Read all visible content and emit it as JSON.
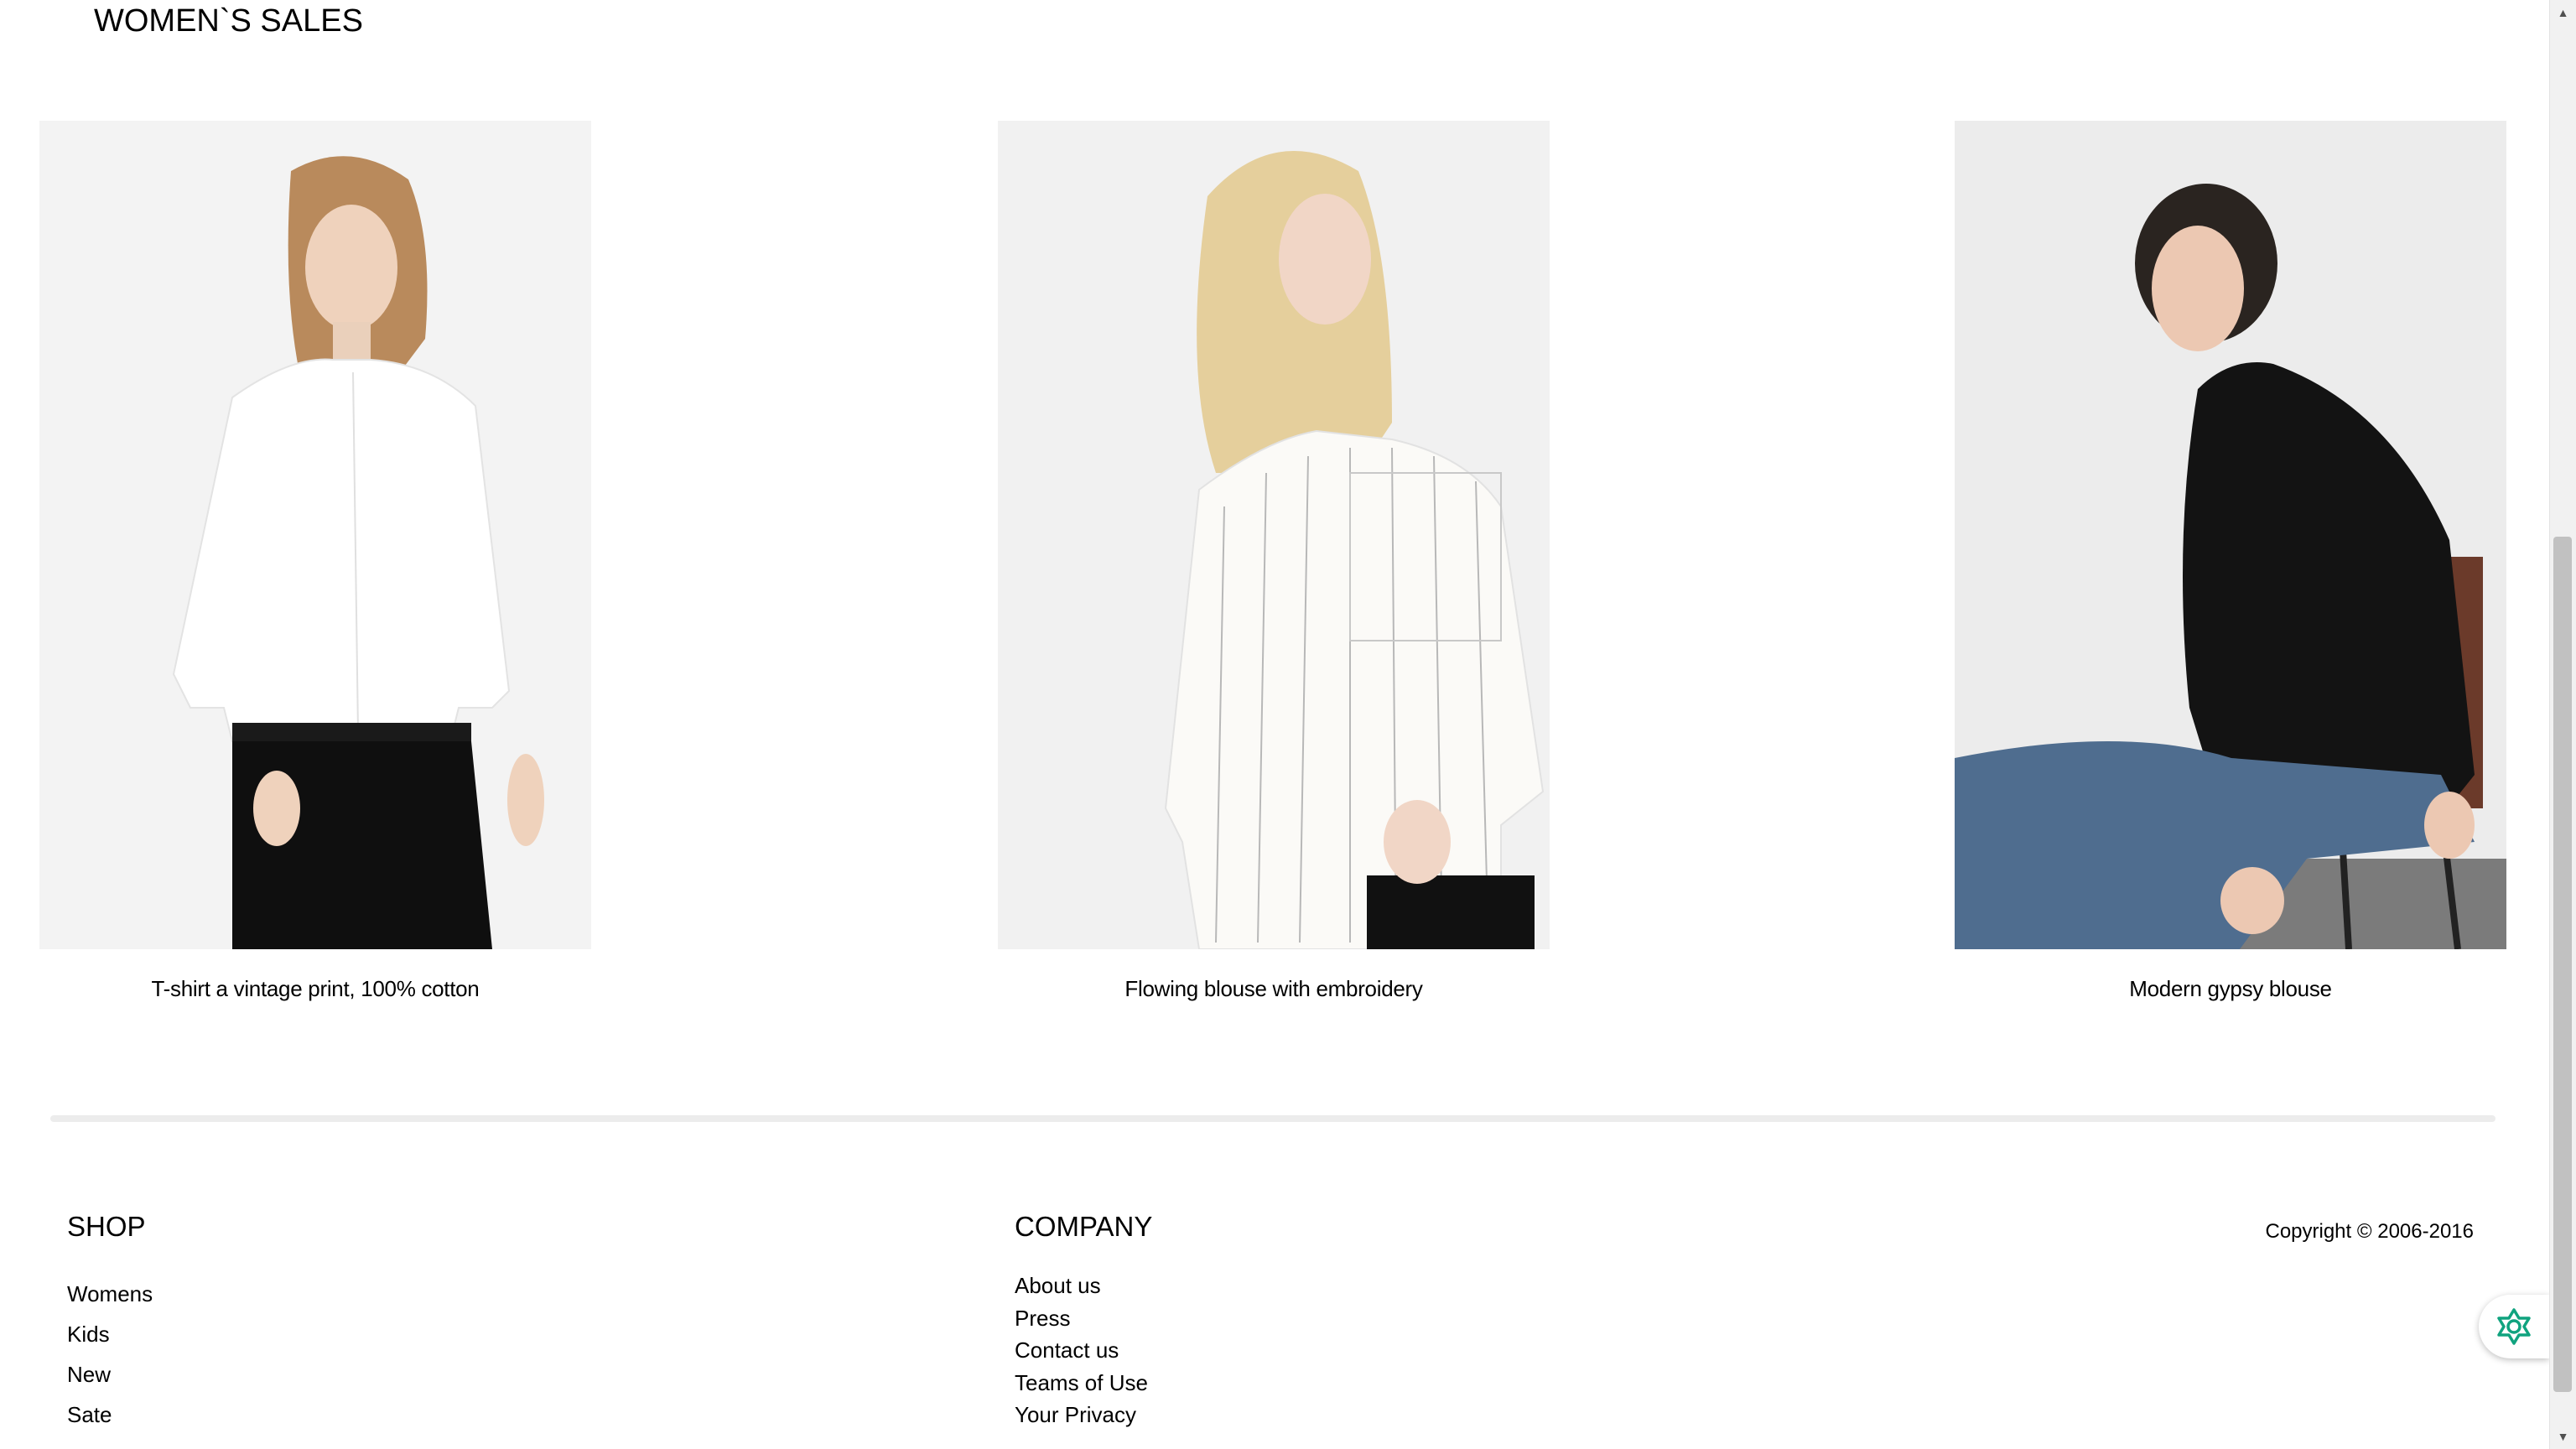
{
  "section": {
    "title": "WOMEN`S SALES"
  },
  "products": [
    {
      "name": "T-shirt a vintage print, 100% cotton"
    },
    {
      "name": "Flowing blouse with embroidery"
    },
    {
      "name": "Modern gypsy blouse"
    }
  ],
  "footer": {
    "shop": {
      "heading": "SHOP",
      "links": [
        "Womens",
        "Kids",
        "New",
        "Sate"
      ]
    },
    "company": {
      "heading": "COMPANY",
      "links": [
        "About us",
        "Press",
        "Contact us",
        "Teams of Use",
        "Your Privacy"
      ]
    },
    "copyright": "Copyright © 2006-2016"
  },
  "icons": {
    "assistant": "assistant-flower-icon",
    "scroll_up": "scroll-up-arrow-icon",
    "scroll_down": "scroll-down-arrow-icon"
  },
  "colors": {
    "assistant_icon": "#10a37f",
    "divider": "#ececec",
    "text": "#000000"
  }
}
